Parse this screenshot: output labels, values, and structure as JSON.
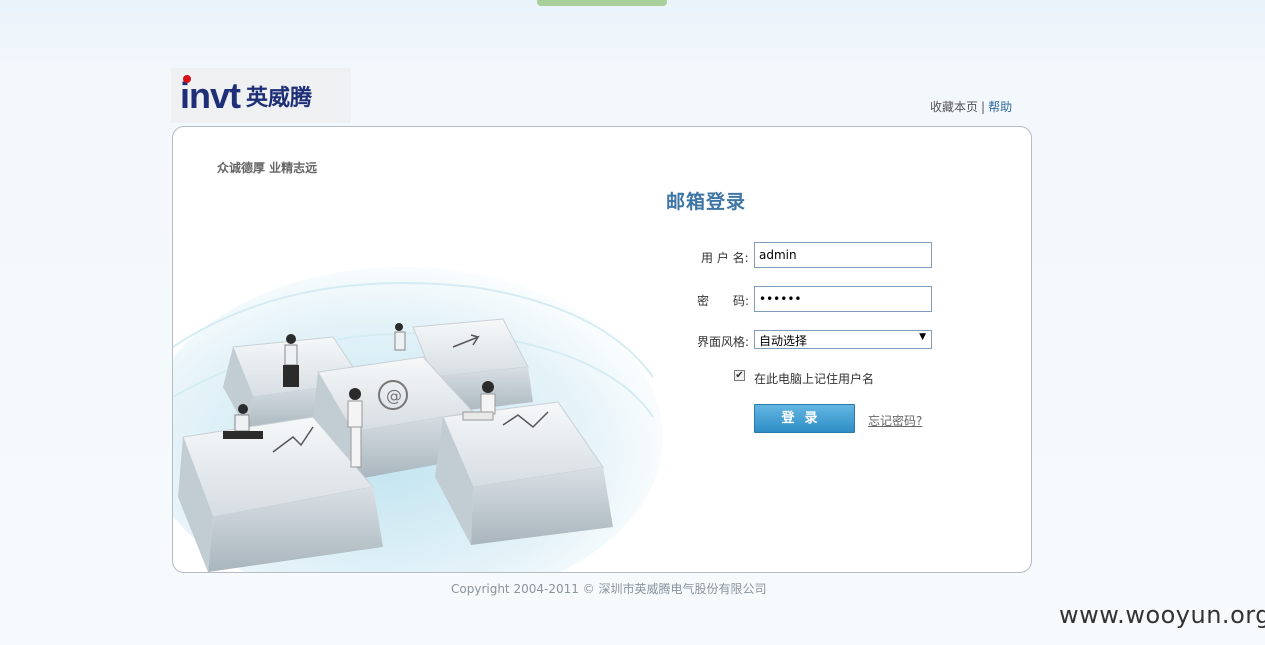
{
  "logo": {
    "en": "invt",
    "cn": "英威腾"
  },
  "toplinks": {
    "bookmark": "收藏本页",
    "separator": "|",
    "help": "帮助"
  },
  "slogan": "众诚德厚 业精志远",
  "form": {
    "title": "邮箱登录",
    "username_label": "用 户 名:",
    "username_value": "admin",
    "password_label": "密　　码:",
    "password_value": "••••••",
    "style_label": "界面风格:",
    "style_value": "自动选择",
    "remember_label": "在此电脑上记住用户名",
    "remember_checked": true,
    "login_button": "登录",
    "forgot_link": "忘记密码?"
  },
  "footer": {
    "copyright": "Copyright 2004-2011 © 深圳市英威腾电气股份有限公司"
  },
  "watermark": "www.wooyun.org",
  "colors": {
    "brand": "#1e2f78",
    "brand_dot": "#d6111a",
    "button": "#3a9bd3",
    "title": "#3f76a5"
  }
}
